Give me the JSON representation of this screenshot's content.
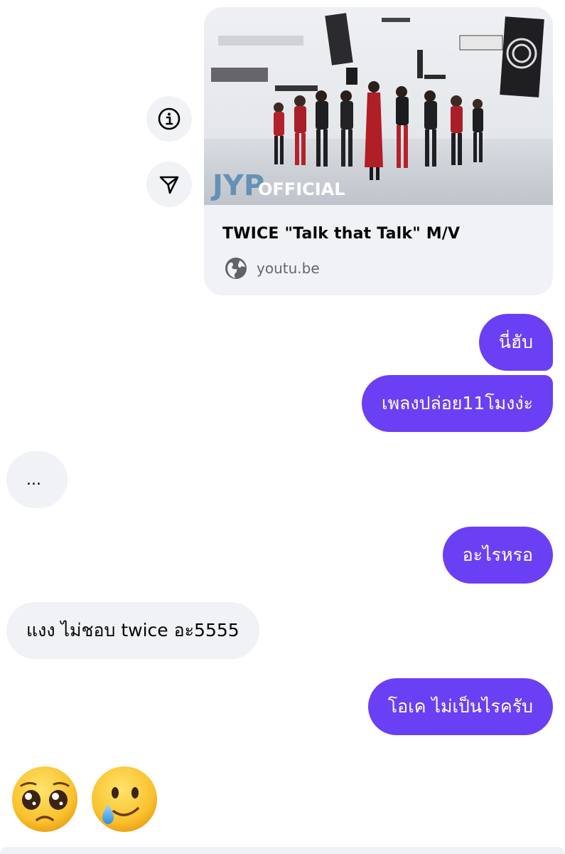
{
  "link_preview": {
    "title": "TWICE \"Talk that Talk\" M/V",
    "domain": "youtu.be",
    "watermark_brand": "JYP",
    "watermark_label": "OFFICIAL"
  },
  "actions": {
    "info_icon": "info-icon",
    "share_icon": "send-icon"
  },
  "messages": [
    {
      "direction": "outgoing",
      "text": "นี่ฮับ"
    },
    {
      "direction": "outgoing",
      "text": "เพลงปล่อย11โมงง่ะ"
    },
    {
      "direction": "incoming",
      "text": "..."
    },
    {
      "direction": "outgoing",
      "text": "อะไรหรอ"
    },
    {
      "direction": "incoming",
      "text": "แงง ไม่ชอบ twice อะ5555"
    },
    {
      "direction": "outgoing",
      "text": "โอเค ไม่เป็นไรครับ"
    }
  ],
  "emoji_reply": [
    "pleading-face",
    "smiling-face-with-tear"
  ],
  "colors": {
    "outgoing_bubble": "#6b3ff3",
    "incoming_bubble": "#f0f2f5",
    "card_background": "#f0f2f5"
  }
}
